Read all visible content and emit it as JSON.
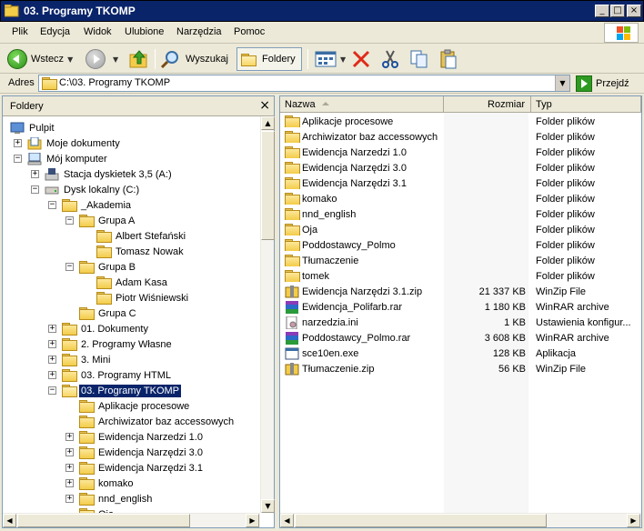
{
  "window": {
    "title": "03. Programy TKOMP",
    "title_color": "#0a246a"
  },
  "menu": [
    "Plik",
    "Edycja",
    "Widok",
    "Ulubione",
    "Narzędzia",
    "Pomoc"
  ],
  "toolbar": {
    "back_label": "Wstecz",
    "search_label": "Wyszukaj",
    "folders_label": "Foldery"
  },
  "address": {
    "label": "Adres",
    "value": "C:\\03. Programy TKOMP",
    "go_label": "Przejdź"
  },
  "folders_pane": {
    "title": "Foldery",
    "tree": [
      {
        "label": "Pulpit",
        "level": 0,
        "expander": "",
        "icon": "desktop-icon"
      },
      {
        "label": "Moje dokumenty",
        "level": 1,
        "expander": "+",
        "icon": "my-documents-icon"
      },
      {
        "label": "Mój komputer",
        "level": 1,
        "expander": "-",
        "icon": "my-computer-icon"
      },
      {
        "label": "Stacja dyskietek 3,5 (A:)",
        "level": 2,
        "expander": "+",
        "icon": "floppy-drive-icon"
      },
      {
        "label": "Dysk lokalny (C:)",
        "level": 2,
        "expander": "-",
        "icon": "hard-drive-icon"
      },
      {
        "label": "_Akademia",
        "level": 3,
        "expander": "-",
        "icon": "folder-icon"
      },
      {
        "label": "Grupa A",
        "level": 4,
        "expander": "-",
        "icon": "folder-icon"
      },
      {
        "label": "Albert Stefański",
        "level": 5,
        "expander": "",
        "icon": "folder-icon"
      },
      {
        "label": "Tomasz Nowak",
        "level": 5,
        "expander": "",
        "icon": "folder-icon"
      },
      {
        "label": "Grupa B",
        "level": 4,
        "expander": "-",
        "icon": "folder-icon"
      },
      {
        "label": "Adam Kasa",
        "level": 5,
        "expander": "",
        "icon": "folder-icon"
      },
      {
        "label": "Piotr Wiśniewski",
        "level": 5,
        "expander": "",
        "icon": "folder-icon"
      },
      {
        "label": "Grupa C",
        "level": 4,
        "expander": "",
        "icon": "folder-icon"
      },
      {
        "label": "01. Dokumenty",
        "level": 3,
        "expander": "+",
        "icon": "folder-icon"
      },
      {
        "label": "2. Programy Własne",
        "level": 3,
        "expander": "+",
        "icon": "folder-icon"
      },
      {
        "label": "3. Mini",
        "level": 3,
        "expander": "+",
        "icon": "folder-icon"
      },
      {
        "label": "03. Programy HTML",
        "level": 3,
        "expander": "+",
        "icon": "folder-icon"
      },
      {
        "label": "03. Programy TKOMP",
        "level": 3,
        "expander": "-",
        "icon": "folder-open-icon",
        "selected": true
      },
      {
        "label": "Aplikacje procesowe",
        "level": 4,
        "expander": "",
        "icon": "folder-icon"
      },
      {
        "label": "Archiwizator baz accessowych",
        "level": 4,
        "expander": "",
        "icon": "folder-icon"
      },
      {
        "label": "Ewidencja Narzedzi 1.0",
        "level": 4,
        "expander": "+",
        "icon": "folder-icon"
      },
      {
        "label": "Ewidencja Narzędzi 3.0",
        "level": 4,
        "expander": "+",
        "icon": "folder-icon"
      },
      {
        "label": "Ewidencja Narzędzi 3.1",
        "level": 4,
        "expander": "+",
        "icon": "folder-icon"
      },
      {
        "label": "komako",
        "level": 4,
        "expander": "+",
        "icon": "folder-icon"
      },
      {
        "label": "nnd_english",
        "level": 4,
        "expander": "+",
        "icon": "folder-icon"
      },
      {
        "label": "Oja",
        "level": 4,
        "expander": "",
        "icon": "folder-icon"
      }
    ]
  },
  "file_list": {
    "columns": [
      "Nazwa",
      "Rozmiar",
      "Typ"
    ],
    "rows": [
      {
        "name": "Aplikacje procesowe",
        "size": "",
        "type": "Folder plików",
        "icon": "folder-icon"
      },
      {
        "name": "Archiwizator baz accessowych",
        "size": "",
        "type": "Folder plików",
        "icon": "folder-icon"
      },
      {
        "name": "Ewidencja Narzedzi 1.0",
        "size": "",
        "type": "Folder plików",
        "icon": "folder-icon"
      },
      {
        "name": "Ewidencja Narzędzi 3.0",
        "size": "",
        "type": "Folder plików",
        "icon": "folder-icon"
      },
      {
        "name": "Ewidencja Narzędzi 3.1",
        "size": "",
        "type": "Folder plików",
        "icon": "folder-icon"
      },
      {
        "name": "komako",
        "size": "",
        "type": "Folder plików",
        "icon": "folder-icon"
      },
      {
        "name": "nnd_english",
        "size": "",
        "type": "Folder plików",
        "icon": "folder-icon"
      },
      {
        "name": "Oja",
        "size": "",
        "type": "Folder plików",
        "icon": "folder-icon"
      },
      {
        "name": "Poddostawcy_Polmo",
        "size": "",
        "type": "Folder plików",
        "icon": "folder-icon"
      },
      {
        "name": "Tłumaczenie",
        "size": "",
        "type": "Folder plików",
        "icon": "folder-icon"
      },
      {
        "name": "tomek",
        "size": "",
        "type": "Folder plików",
        "icon": "folder-icon"
      },
      {
        "name": "Ewidencja Narzędzi 3.1.zip",
        "size": "21 337 KB",
        "type": "WinZip File",
        "icon": "zip-icon"
      },
      {
        "name": "Ewidencja_Polifarb.rar",
        "size": "1 180 KB",
        "type": "WinRAR archive",
        "icon": "rar-icon"
      },
      {
        "name": "narzedzia.ini",
        "size": "1 KB",
        "type": "Ustawienia konfigur...",
        "icon": "ini-file-icon"
      },
      {
        "name": "Poddostawcy_Polmo.rar",
        "size": "3 608 KB",
        "type": "WinRAR archive",
        "icon": "rar-icon"
      },
      {
        "name": "sce10en.exe",
        "size": "128 KB",
        "type": "Aplikacja",
        "icon": "exe-icon"
      },
      {
        "name": "Tłumaczenie.zip",
        "size": "56 KB",
        "type": "WinZip File",
        "icon": "zip-icon"
      }
    ]
  }
}
